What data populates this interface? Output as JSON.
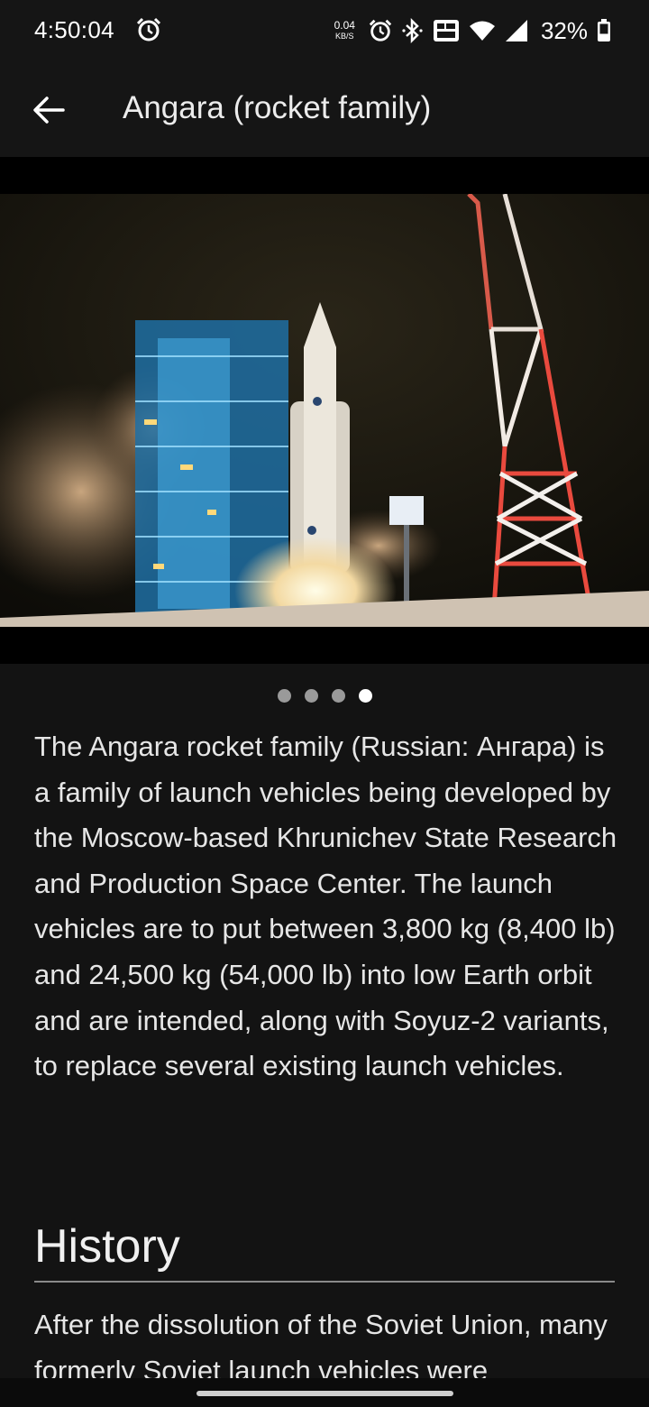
{
  "status_bar": {
    "time": "4:50:04",
    "net_speed_value": "0.04",
    "net_speed_unit": "KB/S",
    "battery_percent": "32%"
  },
  "app_bar": {
    "title": "Angara (rocket family)"
  },
  "gallery": {
    "image_count": 4,
    "active_index": 3
  },
  "article": {
    "summary": "The Angara rocket family (Russian: Ангара) is a family of launch vehicles being developed by the Moscow-based Khrunichev State Research and Production Space Center. The launch vehicles are to put between 3,800 kg (8,400 lb) and 24,500 kg (54,000 lb) into low Earth orbit and are intended, along with Soyuz-2 variants, to replace several existing launch vehicles.",
    "history_heading": "History",
    "history_text": "After the dissolution of the Soviet Union, many formerly Soviet launch vehicles were"
  }
}
